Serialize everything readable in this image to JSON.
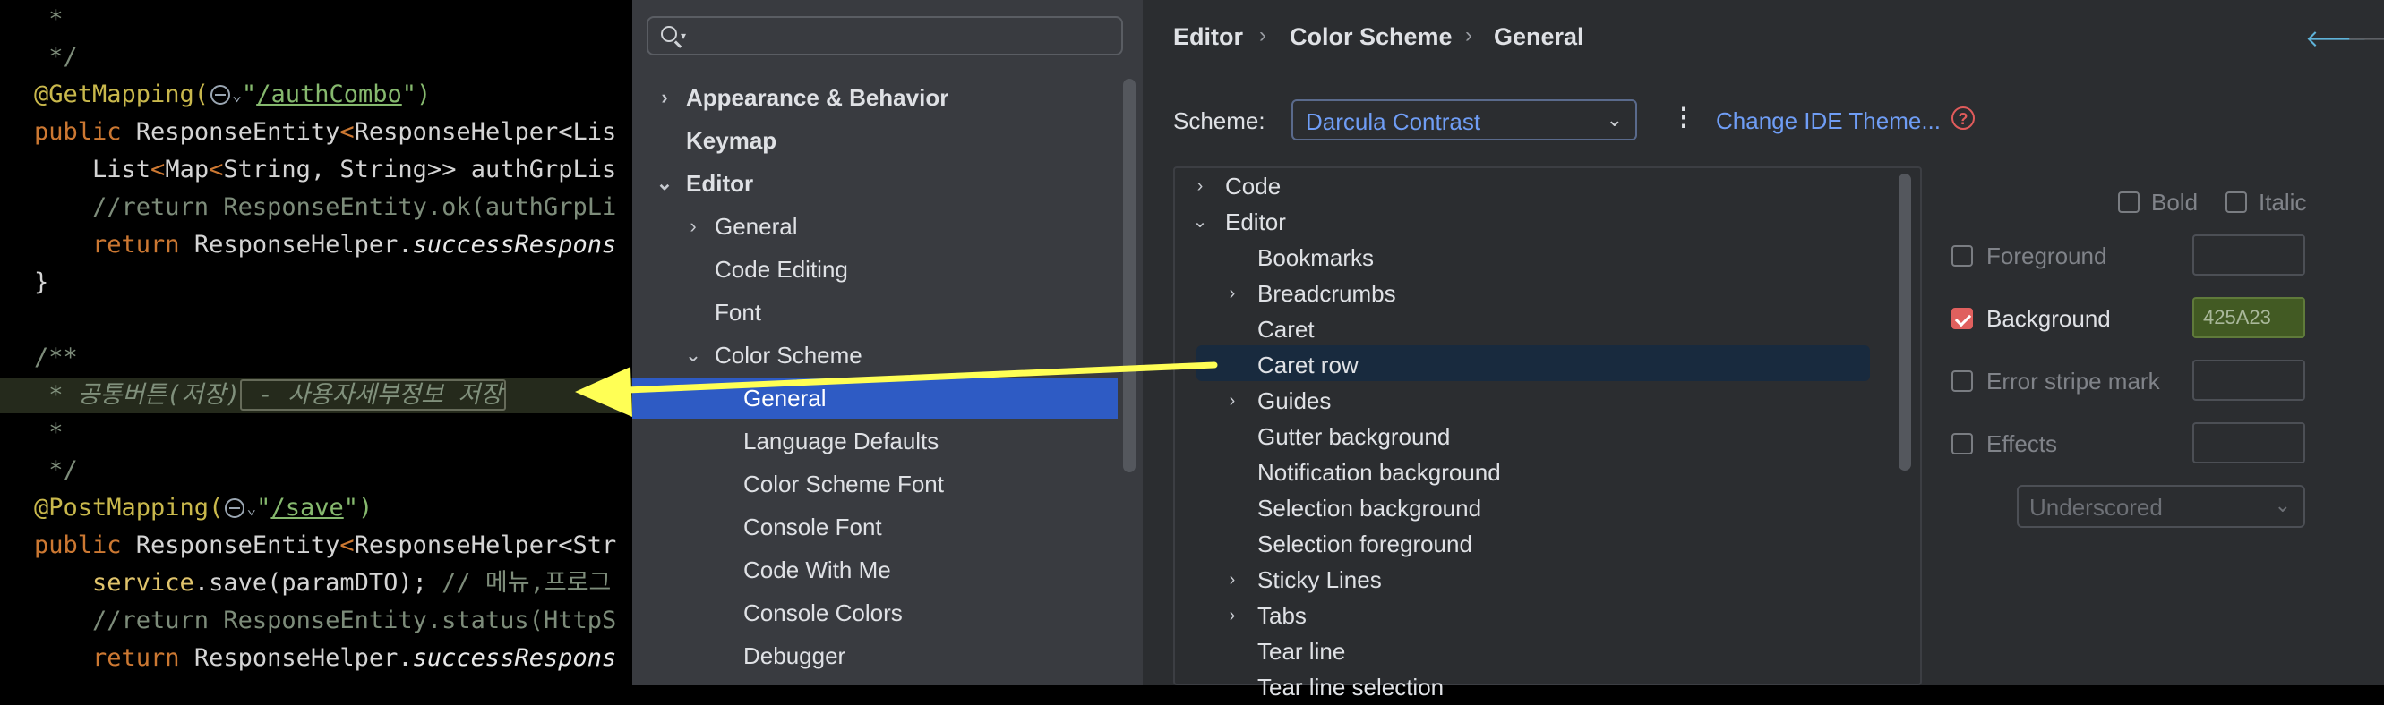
{
  "code": {
    "lines": [
      {
        "parts": [
          {
            "t": " *",
            "c": "cm"
          }
        ]
      },
      {
        "parts": [
          {
            "t": " */",
            "c": "cm"
          }
        ]
      },
      {
        "parts": [
          {
            "t": "@GetMapping(",
            "c": "an"
          },
          {
            "globe": true
          },
          {
            "t": "\"",
            "c": "st"
          },
          {
            "t": "/authCombo",
            "c": "url"
          },
          {
            "t": "\")",
            "c": "st"
          }
        ]
      },
      {
        "parts": [
          {
            "t": "public ",
            "c": "kw"
          },
          {
            "t": "ResponseEntity",
            "c": "ty"
          },
          {
            "t": "<",
            "c": "kw"
          },
          {
            "t": "ResponseHelper",
            "c": "ty"
          },
          {
            "t": "<Lis",
            "c": "ty"
          }
        ]
      },
      {
        "parts": [
          {
            "t": "    List",
            "c": "ty"
          },
          {
            "t": "<",
            "c": "kw"
          },
          {
            "t": "Map",
            "c": "ty"
          },
          {
            "t": "<",
            "c": "kw"
          },
          {
            "t": "String, String>> authGrpLis",
            "c": "ty"
          }
        ]
      },
      {
        "parts": [
          {
            "t": "    //return ResponseEntity.ok(authGrpLi",
            "c": "cm"
          }
        ]
      },
      {
        "parts": [
          {
            "t": "    return ",
            "c": "kw"
          },
          {
            "t": "ResponseHelper.",
            "c": "ty"
          },
          {
            "t": "successRespons",
            "c": "it"
          }
        ]
      },
      {
        "parts": [
          {
            "t": "}",
            "c": "ty"
          }
        ]
      },
      {
        "parts": [
          {
            "t": "",
            "c": "ty"
          }
        ]
      },
      {
        "parts": [
          {
            "t": "/**",
            "c": "cm"
          }
        ]
      },
      {
        "parts": [
          {
            "t": " * 공통버튼(저장)",
            "c": "cmd"
          },
          {
            "t": " - 사용자세부정보 저장",
            "c": "cmd",
            "boxed": true
          }
        ],
        "hl": true
      },
      {
        "parts": [
          {
            "t": " *",
            "c": "cm"
          }
        ]
      },
      {
        "parts": [
          {
            "t": " */",
            "c": "cm"
          }
        ]
      },
      {
        "parts": [
          {
            "t": "@PostMapping(",
            "c": "an"
          },
          {
            "globe": true
          },
          {
            "t": "\"",
            "c": "st"
          },
          {
            "t": "/save",
            "c": "url"
          },
          {
            "t": "\")",
            "c": "st"
          }
        ]
      },
      {
        "parts": [
          {
            "t": "public ",
            "c": "kw"
          },
          {
            "t": "ResponseEntity",
            "c": "ty"
          },
          {
            "t": "<",
            "c": "kw"
          },
          {
            "t": "ResponseHelper",
            "c": "ty"
          },
          {
            "t": "<Str",
            "c": "ty"
          }
        ]
      },
      {
        "parts": [
          {
            "t": "    service",
            "c": "fn"
          },
          {
            "t": ".save(paramDTO); ",
            "c": "ty"
          },
          {
            "t": "// 메뉴,프로그",
            "c": "cm"
          }
        ]
      },
      {
        "parts": [
          {
            "t": "    //return ResponseEntity.status(HttpS",
            "c": "cm"
          }
        ]
      },
      {
        "parts": [
          {
            "t": "    return ",
            "c": "kw"
          },
          {
            "t": "ResponseHelper.",
            "c": "ty"
          },
          {
            "t": "successRespons",
            "c": "it"
          }
        ]
      }
    ]
  },
  "settings": {
    "search_placeholder": "",
    "nav": [
      {
        "label": "Appearance & Behavior",
        "indent": 0,
        "arrow": "›",
        "bold": true
      },
      {
        "label": "Keymap",
        "indent": 0,
        "arrow": "",
        "bold": true
      },
      {
        "label": "Editor",
        "indent": 0,
        "arrow": "⌄",
        "bold": true
      },
      {
        "label": "General",
        "indent": 1,
        "arrow": "›",
        "bold": false
      },
      {
        "label": "Code Editing",
        "indent": 1,
        "arrow": "",
        "bold": false
      },
      {
        "label": "Font",
        "indent": 1,
        "arrow": "",
        "bold": false
      },
      {
        "label": "Color Scheme",
        "indent": 1,
        "arrow": "⌄",
        "bold": false
      },
      {
        "label": "General",
        "indent": 2,
        "arrow": "",
        "bold": false,
        "selected": true
      },
      {
        "label": "Language Defaults",
        "indent": 2,
        "arrow": "",
        "bold": false
      },
      {
        "label": "Color Scheme Font",
        "indent": 2,
        "arrow": "",
        "bold": false
      },
      {
        "label": "Console Font",
        "indent": 2,
        "arrow": "",
        "bold": false
      },
      {
        "label": "Code With Me",
        "indent": 2,
        "arrow": "",
        "bold": false
      },
      {
        "label": "Console Colors",
        "indent": 2,
        "arrow": "",
        "bold": false
      },
      {
        "label": "Debugger",
        "indent": 2,
        "arrow": "",
        "bold": false
      }
    ],
    "breadcrumb": [
      "Editor",
      "Color Scheme",
      "General"
    ],
    "scheme_label": "Scheme:",
    "scheme_value": "Darcula Contrast",
    "change_theme": "Change IDE Theme...",
    "help_glyph": "?",
    "tree": [
      {
        "label": "Code",
        "indent": 0,
        "arrow": "›"
      },
      {
        "label": "Editor",
        "indent": 0,
        "arrow": "⌄"
      },
      {
        "label": "Bookmarks",
        "indent": 1,
        "arrow": ""
      },
      {
        "label": "Breadcrumbs",
        "indent": 1,
        "arrow": "›"
      },
      {
        "label": "Caret",
        "indent": 1,
        "arrow": ""
      },
      {
        "label": "Caret row",
        "indent": 1,
        "arrow": "",
        "selected": true
      },
      {
        "label": "Guides",
        "indent": 1,
        "arrow": "›"
      },
      {
        "label": "Gutter background",
        "indent": 1,
        "arrow": ""
      },
      {
        "label": "Notification background",
        "indent": 1,
        "arrow": ""
      },
      {
        "label": "Selection background",
        "indent": 1,
        "arrow": ""
      },
      {
        "label": "Selection foreground",
        "indent": 1,
        "arrow": ""
      },
      {
        "label": "Sticky Lines",
        "indent": 1,
        "arrow": "›"
      },
      {
        "label": "Tabs",
        "indent": 1,
        "arrow": "›"
      },
      {
        "label": "Tear line",
        "indent": 1,
        "arrow": ""
      },
      {
        "label": "Tear line selection",
        "indent": 1,
        "arrow": ""
      }
    ],
    "attributes": {
      "bold": "Bold",
      "italic": "Italic",
      "foreground": "Foreground",
      "background": "Background",
      "background_value": "425A23",
      "background_checked": true,
      "error_stripe": "Error stripe mark",
      "effects": "Effects",
      "effect_type": "Underscored"
    }
  },
  "colors": {
    "accent_blue": "#2e5bc4",
    "link_blue": "#6f9df5",
    "background_swatch": "#425a23",
    "annotation_arrow": "#ffff55"
  }
}
